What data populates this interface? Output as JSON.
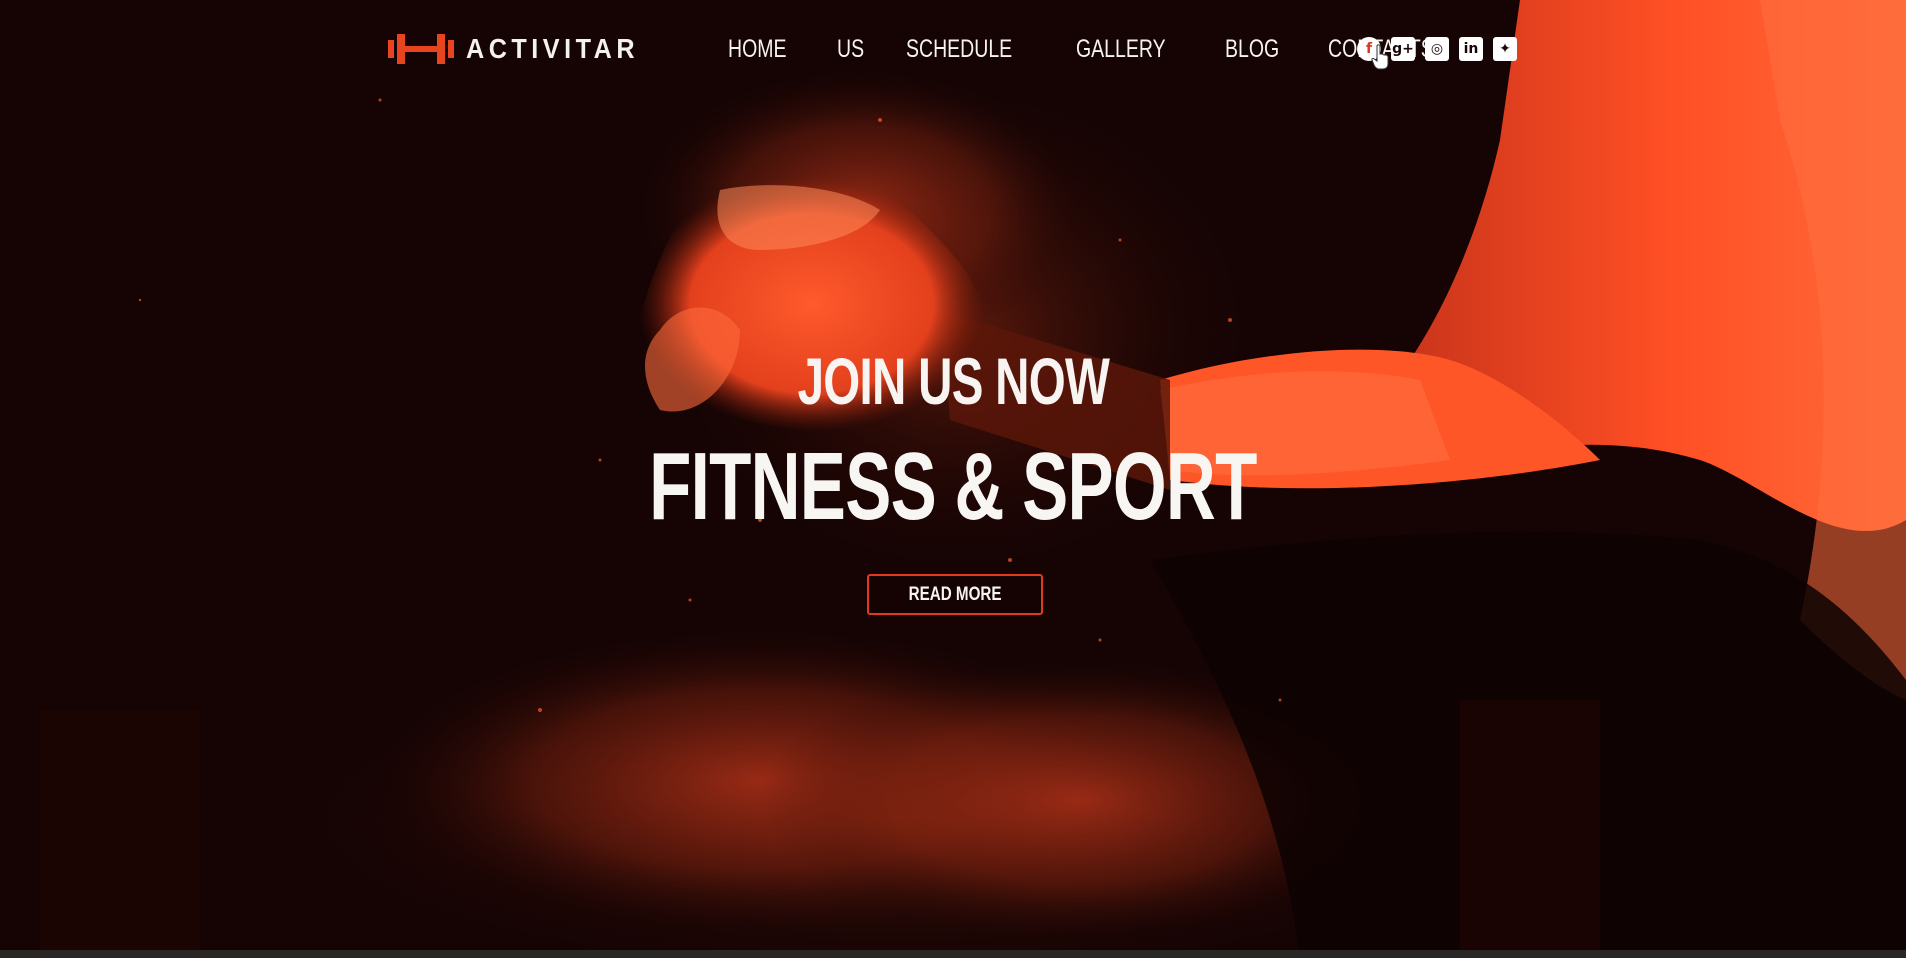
{
  "brand": {
    "name": "ACTIVITAR",
    "logo_icon": "dumbbell-icon",
    "accent_color": "#e8441f"
  },
  "nav": {
    "items": [
      {
        "label": "HOME"
      },
      {
        "label": "US"
      },
      {
        "label": "SCHEDULE"
      },
      {
        "label": "GALLERY"
      },
      {
        "label": "BLOG"
      },
      {
        "label": "CONTACTS"
      }
    ]
  },
  "socials": [
    {
      "icon": "facebook-icon",
      "glyph": "f"
    },
    {
      "icon": "google-plus-icon",
      "glyph": "g+"
    },
    {
      "icon": "instagram-icon",
      "glyph": "◎"
    },
    {
      "icon": "linkedin-icon",
      "glyph": "in"
    },
    {
      "icon": "twitter-icon",
      "glyph": "✦"
    }
  ],
  "hero": {
    "subtitle": "JOIN US NOW",
    "title": "FITNESS & SPORT",
    "button_label": "READ MORE",
    "button_border_color": "#e0391d",
    "background_tint": "#e8441f"
  }
}
